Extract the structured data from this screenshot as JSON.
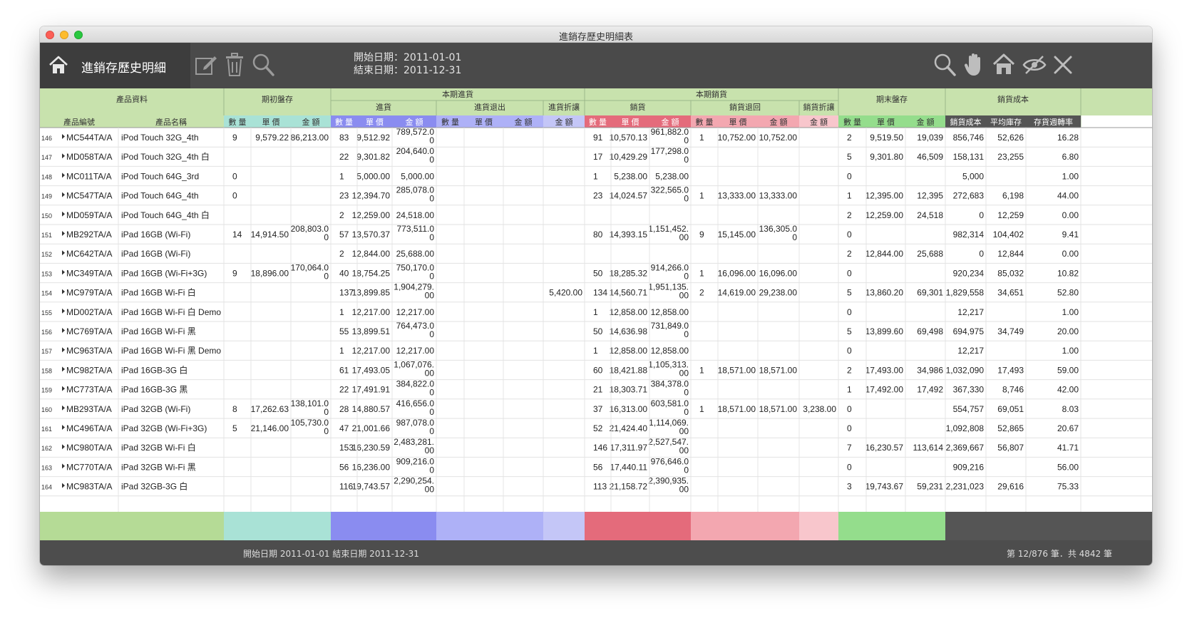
{
  "window": {
    "title": "進銷存歷史明細表"
  },
  "toolbar": {
    "title": "進銷存歷史明細",
    "start_date_label": "開始日期：2011-01-01",
    "end_date_label": "結束日期：2011-12-31"
  },
  "colors": {
    "toolbar_bg": "#4a4a4a",
    "green_header": "#c8e2ad",
    "green_band": "#b5db96",
    "teal_band": "#a9e2d6",
    "blue_band": "#8a8cf0",
    "blue_light_band": "#aeb1f7",
    "blue_pale_band": "#c4c6f7",
    "red_band": "#e46b7b",
    "pink_band": "#f3a7b0",
    "pink_pale_band": "#f8c6cc",
    "green_end_band": "#94dd8c",
    "dark_band": "#555555"
  },
  "header": {
    "groups": [
      "產品資料",
      "期初盤存",
      "本期進貨",
      "本期銷貨",
      "期末盤存",
      "銷貨成本"
    ],
    "subgroups": [
      "進貨",
      "進貨退出",
      "進貨折讓",
      "銷貨",
      "銷貨退回",
      "銷貨折讓"
    ],
    "columns": [
      "產品編號",
      "產品名稱",
      "數 量",
      "單 價",
      "金 額",
      "數 量",
      "單 價",
      "金 額",
      "數 量",
      "單 價",
      "金 額",
      "金 額",
      "數 量",
      "單 價",
      "金 額",
      "數 量",
      "單 價",
      "金 額",
      "金 額",
      "數 量",
      "單 價",
      "金 額",
      "銷貨成本",
      "平均庫存",
      "存貨週轉率"
    ]
  },
  "rows": [
    {
      "no": "146",
      "code": "MC544TA/A",
      "name": "iPod Touch 32G_4th",
      "c": [
        "9",
        "9,579.22",
        "86,213.00",
        "83",
        "9,512.92",
        "789,572.00",
        "",
        "",
        "",
        "",
        "91",
        "10,570.13",
        "961,882.00",
        "1",
        "10,752.00",
        "10,752.00",
        "",
        "2",
        "9,519.50",
        "19,039",
        "856,746",
        "52,626",
        "16.28"
      ]
    },
    {
      "no": "147",
      "code": "MD058TA/A",
      "name": "iPod Touch 32G_4th 白",
      "c": [
        "",
        "",
        "",
        "22",
        "9,301.82",
        "204,640.00",
        "",
        "",
        "",
        "",
        "17",
        "10,429.29",
        "177,298.00",
        "",
        "",
        "",
        "",
        "5",
        "9,301.80",
        "46,509",
        "158,131",
        "23,255",
        "6.80"
      ]
    },
    {
      "no": "148",
      "code": "MC011TA/A",
      "name": "iPod Touch 64G_3rd",
      "c": [
        "0",
        "",
        "",
        "1",
        "5,000.00",
        "5,000.00",
        "",
        "",
        "",
        "",
        "1",
        "5,238.00",
        "5,238.00",
        "",
        "",
        "",
        "",
        "0",
        "",
        "",
        "5,000",
        "",
        "1.00"
      ]
    },
    {
      "no": "149",
      "code": "MC547TA/A",
      "name": "iPod Touch 64G_4th",
      "c": [
        "0",
        "",
        "",
        "23",
        "12,394.70",
        "285,078.00",
        "",
        "",
        "",
        "",
        "23",
        "14,024.57",
        "322,565.00",
        "1",
        "13,333.00",
        "13,333.00",
        "",
        "1",
        "12,395.00",
        "12,395",
        "272,683",
        "6,198",
        "44.00"
      ]
    },
    {
      "no": "150",
      "code": "MD059TA/A",
      "name": "iPod Touch 64G_4th 白",
      "c": [
        "",
        "",
        "",
        "2",
        "12,259.00",
        "24,518.00",
        "",
        "",
        "",
        "",
        "",
        "",
        "",
        "",
        "",
        "",
        "",
        "2",
        "12,259.00",
        "24,518",
        "0",
        "12,259",
        "0.00"
      ]
    },
    {
      "no": "151",
      "code": "MB292TA/A",
      "name": "iPad 16GB (Wi-Fi)",
      "c": [
        "14",
        "14,914.50",
        "208,803.00",
        "57",
        "13,570.37",
        "773,511.00",
        "",
        "",
        "",
        "",
        "80",
        "14,393.15",
        "1,151,452.00",
        "9",
        "15,145.00",
        "136,305.00",
        "",
        "0",
        "",
        "",
        "982,314",
        "104,402",
        "9.41"
      ]
    },
    {
      "no": "152",
      "code": "MC642TA/A",
      "name": "iPad 16GB (Wi-Fi)",
      "c": [
        "",
        "",
        "",
        "2",
        "12,844.00",
        "25,688.00",
        "",
        "",
        "",
        "",
        "",
        "",
        "",
        "",
        "",
        "",
        "",
        "2",
        "12,844.00",
        "25,688",
        "0",
        "12,844",
        "0.00"
      ]
    },
    {
      "no": "153",
      "code": "MC349TA/A",
      "name": "iPad 16GB (Wi-Fi+3G)",
      "c": [
        "9",
        "18,896.00",
        "170,064.00",
        "40",
        "18,754.25",
        "750,170.00",
        "",
        "",
        "",
        "",
        "50",
        "18,285.32",
        "914,266.00",
        "1",
        "16,096.00",
        "16,096.00",
        "",
        "0",
        "",
        "",
        "920,234",
        "85,032",
        "10.82"
      ]
    },
    {
      "no": "154",
      "code": "MC979TA/A",
      "name": "iPad 16GB Wi-Fi 白",
      "c": [
        "",
        "",
        "",
        "137",
        "13,899.85",
        "1,904,279.00",
        "",
        "",
        "",
        "5,420.00",
        "134",
        "14,560.71",
        "1,951,135.00",
        "2",
        "14,619.00",
        "29,238.00",
        "",
        "5",
        "13,860.20",
        "69,301",
        "1,829,558",
        "34,651",
        "52.80"
      ]
    },
    {
      "no": "155",
      "code": "MD002TA/A",
      "name": "iPad 16GB Wi-Fi 白 Demo",
      "c": [
        "",
        "",
        "",
        "1",
        "12,217.00",
        "12,217.00",
        "",
        "",
        "",
        "",
        "1",
        "12,858.00",
        "12,858.00",
        "",
        "",
        "",
        "",
        "0",
        "",
        "",
        "12,217",
        "",
        "1.00"
      ]
    },
    {
      "no": "156",
      "code": "MC769TA/A",
      "name": "iPad 16GB Wi-Fi 黑",
      "c": [
        "",
        "",
        "",
        "55",
        "13,899.51",
        "764,473.00",
        "",
        "",
        "",
        "",
        "50",
        "14,636.98",
        "731,849.00",
        "",
        "",
        "",
        "",
        "5",
        "13,899.60",
        "69,498",
        "694,975",
        "34,749",
        "20.00"
      ]
    },
    {
      "no": "157",
      "code": "MC963TA/A",
      "name": "iPad 16GB Wi-Fi 黑 Demo",
      "c": [
        "",
        "",
        "",
        "1",
        "12,217.00",
        "12,217.00",
        "",
        "",
        "",
        "",
        "1",
        "12,858.00",
        "12,858.00",
        "",
        "",
        "",
        "",
        "0",
        "",
        "",
        "12,217",
        "",
        "1.00"
      ]
    },
    {
      "no": "158",
      "code": "MC982TA/A",
      "name": "iPad 16GB-3G 白",
      "c": [
        "",
        "",
        "",
        "61",
        "17,493.05",
        "1,067,076.00",
        "",
        "",
        "",
        "",
        "60",
        "18,421.88",
        "1,105,313.00",
        "1",
        "18,571.00",
        "18,571.00",
        "",
        "2",
        "17,493.00",
        "34,986",
        "1,032,090",
        "17,493",
        "59.00"
      ]
    },
    {
      "no": "159",
      "code": "MC773TA/A",
      "name": "iPad 16GB-3G 黑",
      "c": [
        "",
        "",
        "",
        "22",
        "17,491.91",
        "384,822.00",
        "",
        "",
        "",
        "",
        "21",
        "18,303.71",
        "384,378.00",
        "",
        "",
        "",
        "",
        "1",
        "17,492.00",
        "17,492",
        "367,330",
        "8,746",
        "42.00"
      ]
    },
    {
      "no": "160",
      "code": "MB293TA/A",
      "name": "iPad 32GB (Wi-Fi)",
      "c": [
        "8",
        "17,262.63",
        "138,101.00",
        "28",
        "14,880.57",
        "416,656.00",
        "",
        "",
        "",
        "",
        "37",
        "16,313.00",
        "603,581.00",
        "1",
        "18,571.00",
        "18,571.00",
        "3,238.00",
        "0",
        "",
        "",
        "554,757",
        "69,051",
        "8.03"
      ]
    },
    {
      "no": "161",
      "code": "MC496TA/A",
      "name": "iPad 32GB (Wi-Fi+3G)",
      "c": [
        "5",
        "21,146.00",
        "105,730.00",
        "47",
        "21,001.66",
        "987,078.00",
        "",
        "",
        "",
        "",
        "52",
        "21,424.40",
        "1,114,069.00",
        "",
        "",
        "",
        "",
        "0",
        "",
        "",
        "1,092,808",
        "52,865",
        "20.67"
      ]
    },
    {
      "no": "162",
      "code": "MC980TA/A",
      "name": "iPad 32GB Wi-Fi 白",
      "c": [
        "",
        "",
        "",
        "153",
        "16,230.59",
        "2,483,281.00",
        "",
        "",
        "",
        "",
        "146",
        "17,311.97",
        "2,527,547.00",
        "",
        "",
        "",
        "",
        "7",
        "16,230.57",
        "113,614",
        "2,369,667",
        "56,807",
        "41.71"
      ]
    },
    {
      "no": "163",
      "code": "MC770TA/A",
      "name": "iPad 32GB Wi-Fi 黑",
      "c": [
        "",
        "",
        "",
        "56",
        "16,236.00",
        "909,216.00",
        "",
        "",
        "",
        "",
        "56",
        "17,440.11",
        "976,646.00",
        "",
        "",
        "",
        "",
        "0",
        "",
        "",
        "909,216",
        "",
        "56.00"
      ]
    },
    {
      "no": "164",
      "code": "MC983TA/A",
      "name": "iPad 32GB-3G 白",
      "c": [
        "",
        "",
        "",
        "116",
        "19,743.57",
        "2,290,254.00",
        "",
        "",
        "",
        "",
        "113",
        "21,158.72",
        "2,390,935.00",
        "",
        "",
        "",
        "",
        "3",
        "19,743.67",
        "59,231",
        "2,231,023",
        "29,616",
        "75.33"
      ]
    }
  ],
  "status": {
    "date_range": "開始日期 2011-01-01 結束日期 2011-12-31",
    "record_info": "第 12/876 筆．共 4842 筆"
  }
}
